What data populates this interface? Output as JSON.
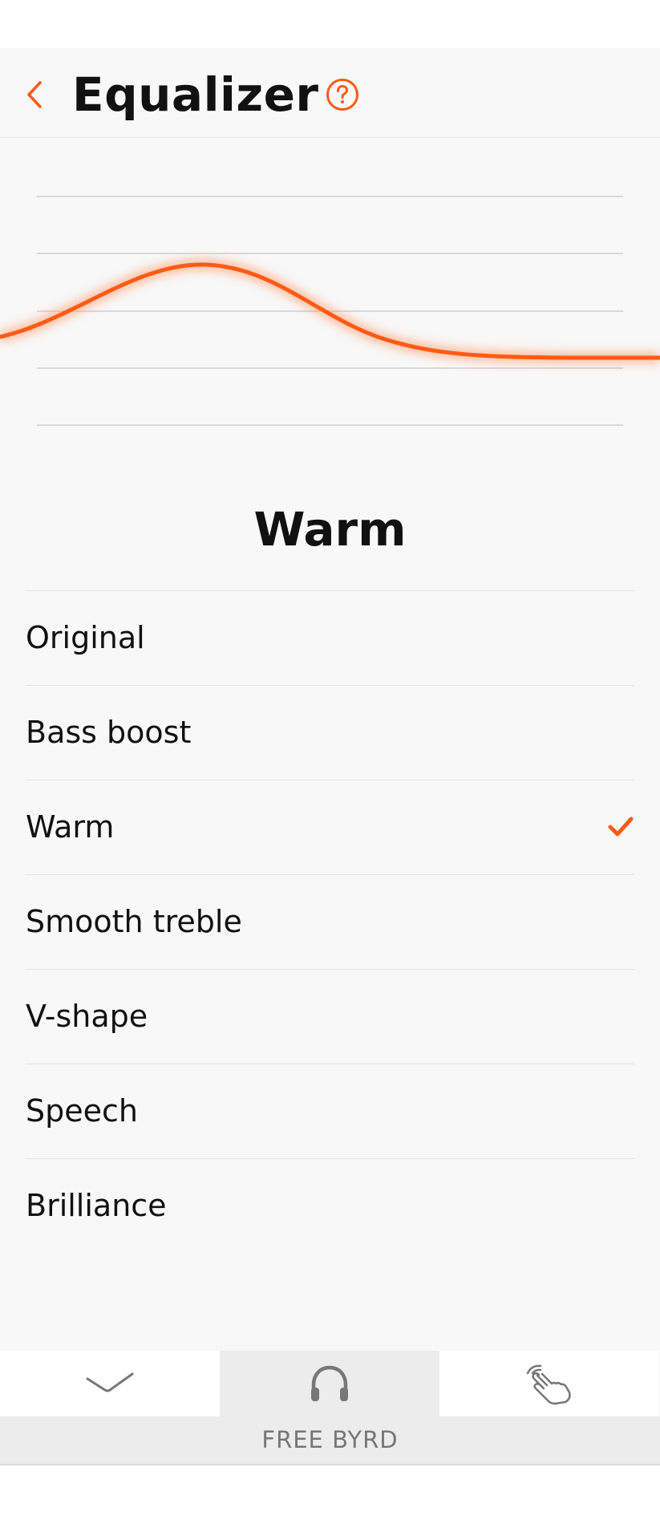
{
  "header": {
    "title": "Equalizer",
    "back_icon": "chevron-left-icon",
    "help_icon": "help-circle-icon"
  },
  "equalizer": {
    "current_preset": "Warm"
  },
  "presets": [
    {
      "label": "Original",
      "selected": false
    },
    {
      "label": "Bass boost",
      "selected": false
    },
    {
      "label": "Warm",
      "selected": true
    },
    {
      "label": "Smooth treble",
      "selected": false
    },
    {
      "label": "V-shape",
      "selected": false
    },
    {
      "label": "Speech",
      "selected": false
    },
    {
      "label": "Brilliance",
      "selected": false
    }
  ],
  "tabs": [
    {
      "icon": "check-icon",
      "active": false
    },
    {
      "icon": "headphones-icon",
      "active": true
    },
    {
      "icon": "touch-gesture-icon",
      "active": false
    }
  ],
  "device": {
    "name": "FREE BYRD"
  },
  "colors": {
    "accent": "#ff5a14",
    "background": "#f8f8f8",
    "active_tab": "#ececec",
    "divider": "#e4e4e4"
  }
}
